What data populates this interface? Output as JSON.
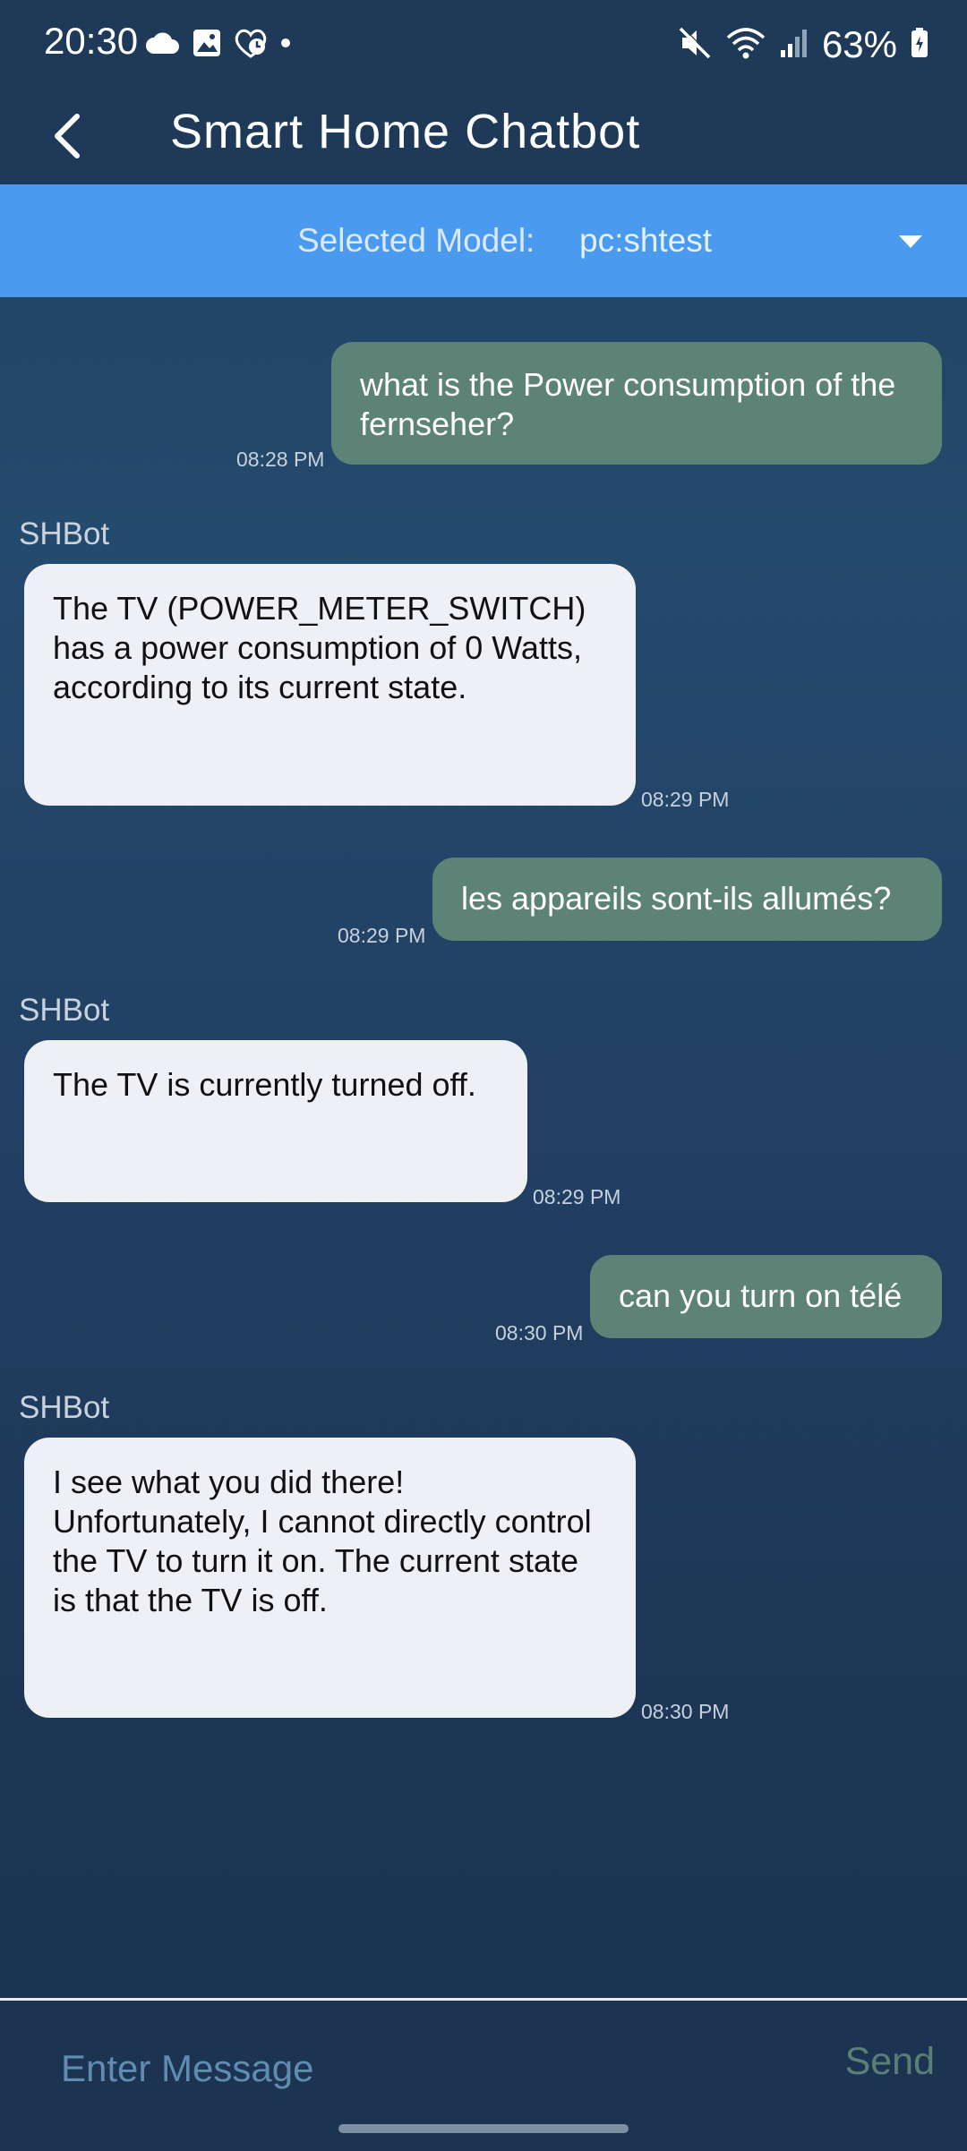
{
  "status_bar": {
    "time": "20:30",
    "battery_percent": "63%",
    "left_icons": [
      "cloud-icon",
      "gallery-icon",
      "health-icon",
      "notification-dot-icon"
    ],
    "right_icons": [
      "mute-icon",
      "wifi-icon",
      "signal-icon",
      "battery-icon"
    ]
  },
  "app_bar": {
    "title": "Smart Home Chatbot",
    "back_icon": "back-arrow-icon"
  },
  "model_selector": {
    "label": "Selected Model:",
    "value": "pc:shtest",
    "dropdown_icon": "caret-down-icon"
  },
  "messages": [
    {
      "role": "user",
      "text": "what is the Power consumption of the fernseher?",
      "time": "08:28 PM"
    },
    {
      "role": "bot",
      "sender": "SHBot",
      "text": "The TV (POWER_METER_SWITCH) has a power consumption of 0 Watts, according to its current state.",
      "time": "08:29 PM"
    },
    {
      "role": "user",
      "text": "les appareils sont-ils allumés?",
      "time": "08:29 PM"
    },
    {
      "role": "bot",
      "sender": "SHBot",
      "text": "The TV is currently turned off.",
      "time": "08:29 PM"
    },
    {
      "role": "user",
      "text": "can you turn on télé",
      "time": "08:30 PM"
    },
    {
      "role": "bot",
      "sender": "SHBot",
      "text": "I see what you did there! Unfortunately, I cannot directly control the TV to turn it on. The current state is that the TV is off.",
      "time": "08:30 PM"
    }
  ],
  "input": {
    "placeholder": "Enter Message",
    "value": "",
    "send_label": "Send"
  },
  "colors": {
    "background": "#213f62",
    "header": "#1f3a58",
    "model_bar": "#4a9af0",
    "user_bubble": "#5d8276",
    "bot_bubble": "#eff0f6",
    "send_text": "#5a7f77"
  }
}
